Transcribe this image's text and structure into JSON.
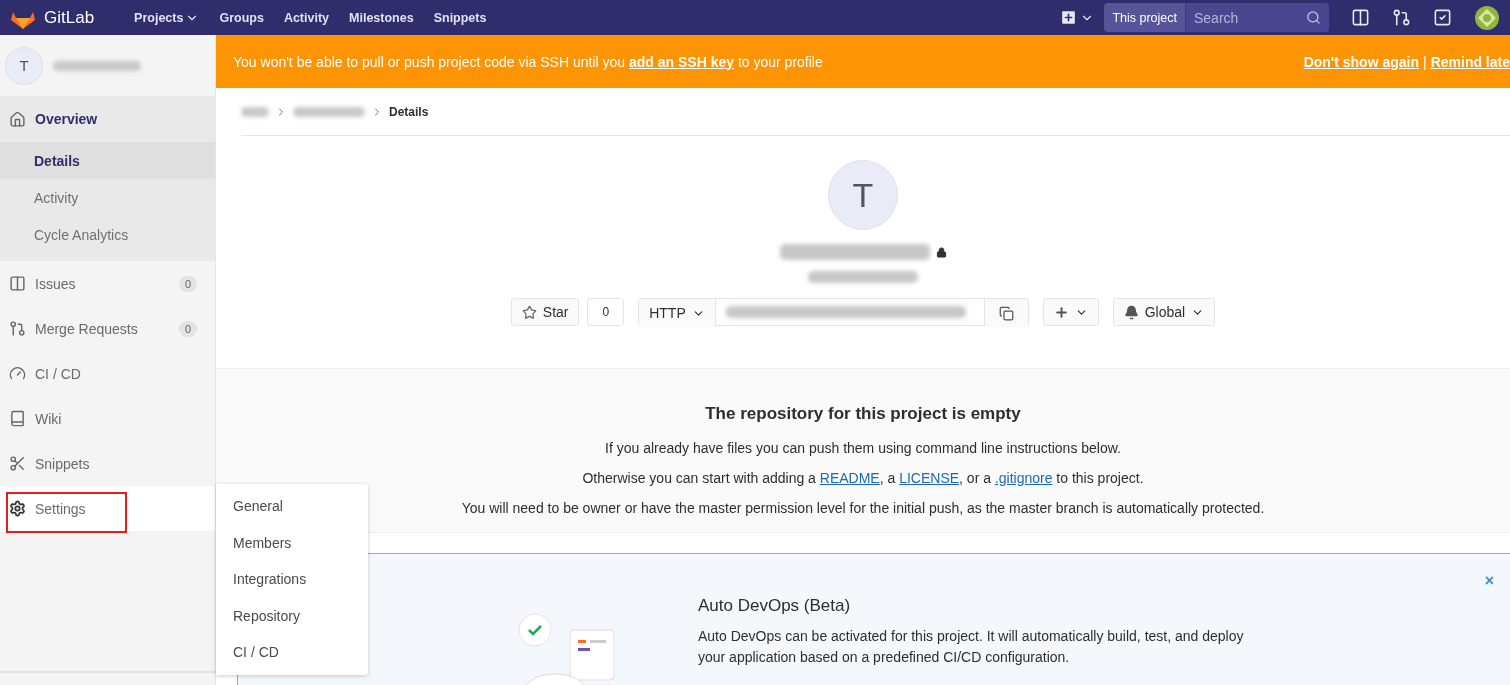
{
  "nav": {
    "brand": "GitLab",
    "links": [
      {
        "label": "Projects",
        "dropdown": true
      },
      {
        "label": "Groups",
        "dropdown": false
      },
      {
        "label": "Activity",
        "dropdown": false
      },
      {
        "label": "Milestones",
        "dropdown": false
      },
      {
        "label": "Snippets",
        "dropdown": false
      }
    ],
    "search": {
      "scope": "This project",
      "placeholder": "Search"
    }
  },
  "banner": {
    "before": "You won't be able to pull or push project code via SSH until you ",
    "link": "add an SSH key",
    "after": " to your profile",
    "actions": [
      "Don't show again",
      "|",
      "Remind late"
    ]
  },
  "sidebar": {
    "avatar": "T",
    "items": [
      {
        "kind": "section",
        "label": "Overview",
        "selected": true,
        "children": [
          {
            "label": "Details",
            "selected": true
          },
          {
            "label": "Activity",
            "selected": false
          },
          {
            "label": "Cycle Analytics",
            "selected": false
          }
        ]
      },
      {
        "kind": "item",
        "label": "Issues",
        "count": "0",
        "selected": false
      },
      {
        "kind": "item",
        "label": "Merge Requests",
        "count": "0",
        "selected": false
      },
      {
        "kind": "item",
        "label": "CI / CD",
        "selected": false
      },
      {
        "kind": "item",
        "label": "Wiki",
        "selected": false
      },
      {
        "kind": "item",
        "label": "Snippets",
        "selected": false
      },
      {
        "kind": "item",
        "label": "Settings",
        "selected": false,
        "highlighted": true,
        "flyout": [
          "General",
          "Members",
          "Integrations",
          "Repository",
          "CI / CD"
        ]
      }
    ]
  },
  "breadcrumb": {
    "current": "Details"
  },
  "project": {
    "avatar": "T",
    "star": {
      "label": "Star",
      "count": "0"
    },
    "clone": {
      "protocol": "HTTP"
    },
    "notification": "Global"
  },
  "empty_repo": {
    "title": "The repository for this project is empty",
    "lines": [
      [
        {
          "text": "If you already have files you can push them using command line instructions below."
        }
      ],
      [
        {
          "text": "Otherwise you can start with adding a "
        },
        {
          "link": "README"
        },
        {
          "text": ", a "
        },
        {
          "link": "LICENSE"
        },
        {
          "text": ", or a "
        },
        {
          "link": ".gitignore"
        },
        {
          "text": " to this project."
        }
      ],
      [
        {
          "text": "You will need to be owner or have the master permission level for the initial push, as the master branch is automatically protected."
        }
      ]
    ]
  },
  "auto_devops": {
    "title": "Auto DevOps (Beta)",
    "body": "Auto DevOps can be activated for this project. It will automatically build, test, and deploy your application based on a predefined CI/CD configuration.",
    "close": "×"
  }
}
